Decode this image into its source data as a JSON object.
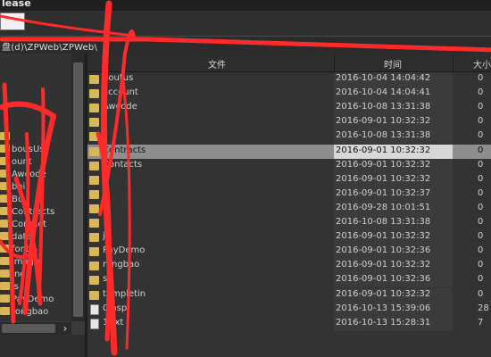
{
  "window": {
    "title": "lease"
  },
  "path": {
    "text": "盘(d)\\ZPWeb\\ZPWeb\\"
  },
  "tree": {
    "items": [
      {
        "label": "",
        "top": 0
      },
      {
        "label": "bousUs"
      },
      {
        "label": "ount"
      },
      {
        "label": "Awcode"
      },
      {
        "label": "bai"
      },
      {
        "label": "Bu"
      },
      {
        "label": "Contracts"
      },
      {
        "label": "Contact"
      },
      {
        "label": "data"
      },
      {
        "label": "fonts"
      },
      {
        "label": "image"
      },
      {
        "label": "Inc"
      },
      {
        "label": "js"
      },
      {
        "label": "PayDemo"
      },
      {
        "label": "rongbao"
      }
    ]
  },
  "list": {
    "headers": {
      "name": "文件",
      "time": "时间",
      "size": "大小"
    },
    "rows": [
      {
        "type": "folder",
        "name": "boutus",
        "time": "2016-10-04 14:04:42",
        "size": "0"
      },
      {
        "type": "folder",
        "name": "account",
        "time": "2016-10-04 14:04:41",
        "size": "0"
      },
      {
        "type": "folder",
        "name": "Awcode",
        "time": "2016-10-08 13:31:38",
        "size": "0"
      },
      {
        "type": "folder",
        "name": "",
        "time": "2016-09-01 10:32:32",
        "size": "0"
      },
      {
        "type": "folder",
        "name": "",
        "time": "2016-10-08 13:31:38",
        "size": "0"
      },
      {
        "type": "folder",
        "name": "Contracts",
        "time": "2016-09-01 10:32:32",
        "size": "0",
        "selected": true
      },
      {
        "type": "folder",
        "name": "Contacts",
        "time": "2016-09-01 10:32:32",
        "size": "0"
      },
      {
        "type": "folder",
        "name": "",
        "time": "2016-09-01 10:32:32",
        "size": "0"
      },
      {
        "type": "folder",
        "name": "",
        "time": "2016-09-01 10:32:37",
        "size": "0"
      },
      {
        "type": "folder",
        "name": "",
        "time": "2016-09-28 10:01:51",
        "size": "0"
      },
      {
        "type": "folder",
        "name": "",
        "time": "2016-10-08 13:31:38",
        "size": "0"
      },
      {
        "type": "folder",
        "name": "js",
        "time": "2016-09-01 10:32:32",
        "size": "0"
      },
      {
        "type": "folder",
        "name": "PayDemo",
        "time": "2016-09-01 10:32:36",
        "size": "0"
      },
      {
        "type": "folder",
        "name": "rongbao",
        "time": "2016-09-01 10:32:32",
        "size": "0"
      },
      {
        "type": "folder",
        "name": "s",
        "time": "2016-09-01 10:32:36",
        "size": "0"
      },
      {
        "type": "folder",
        "name": "templetin",
        "time": "2016-09-01 10:32:32",
        "size": "0"
      },
      {
        "type": "file",
        "name": "0.asp",
        "time": "2016-10-13 15:39:06",
        "size": "28"
      },
      {
        "type": "file",
        "name": "1.txt",
        "time": "2016-10-13 15:28:31",
        "size": "7"
      }
    ]
  },
  "hscroll": {
    "arrow": "›"
  }
}
